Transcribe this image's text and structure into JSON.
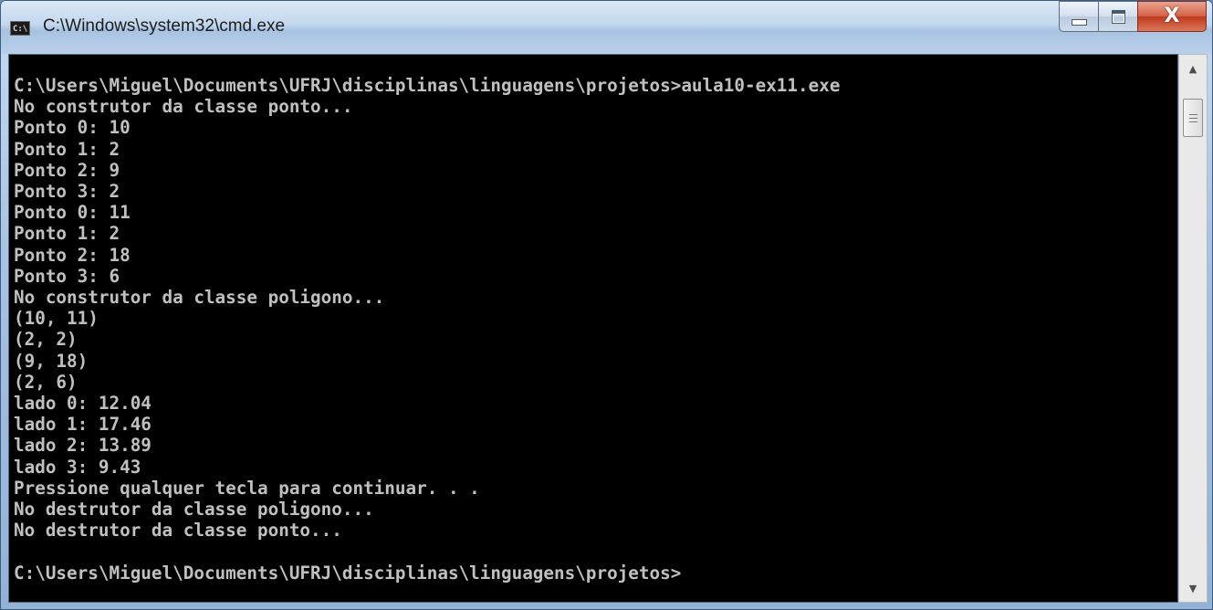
{
  "window": {
    "title": "C:\\Windows\\system32\\cmd.exe",
    "icon": "cmd-icon",
    "icon_text": "C:\\"
  },
  "controls": {
    "minimize": "minimize-icon",
    "maximize": "maximize-icon",
    "close": "close-icon",
    "close_glyph": "X"
  },
  "console": {
    "background": "#000000",
    "foreground": "#c0c0c0",
    "lines": [
      "C:\\Users\\Miguel\\Documents\\UFRJ\\disciplinas\\linguagens\\projetos>aula10-ex11.exe",
      "No construtor da classe ponto...",
      "Ponto 0: 10",
      "Ponto 1: 2",
      "Ponto 2: 9",
      "Ponto 3: 2",
      "Ponto 0: 11",
      "Ponto 1: 2",
      "Ponto 2: 18",
      "Ponto 3: 6",
      "No construtor da classe poligono...",
      "(10, 11)",
      "(2, 2)",
      "(9, 18)",
      "(2, 6)",
      "lado 0: 12.04",
      "lado 1: 17.46",
      "lado 2: 13.89",
      "lado 3: 9.43",
      "Pressione qualquer tecla para continuar. . .",
      "No destrutor da classe poligono...",
      "No destrutor da classe ponto...",
      "",
      "C:\\Users\\Miguel\\Documents\\UFRJ\\disciplinas\\linguagens\\projetos>"
    ]
  },
  "scrollbar": {
    "up": "scroll-up-arrow-icon",
    "down": "scroll-down-arrow-icon"
  }
}
